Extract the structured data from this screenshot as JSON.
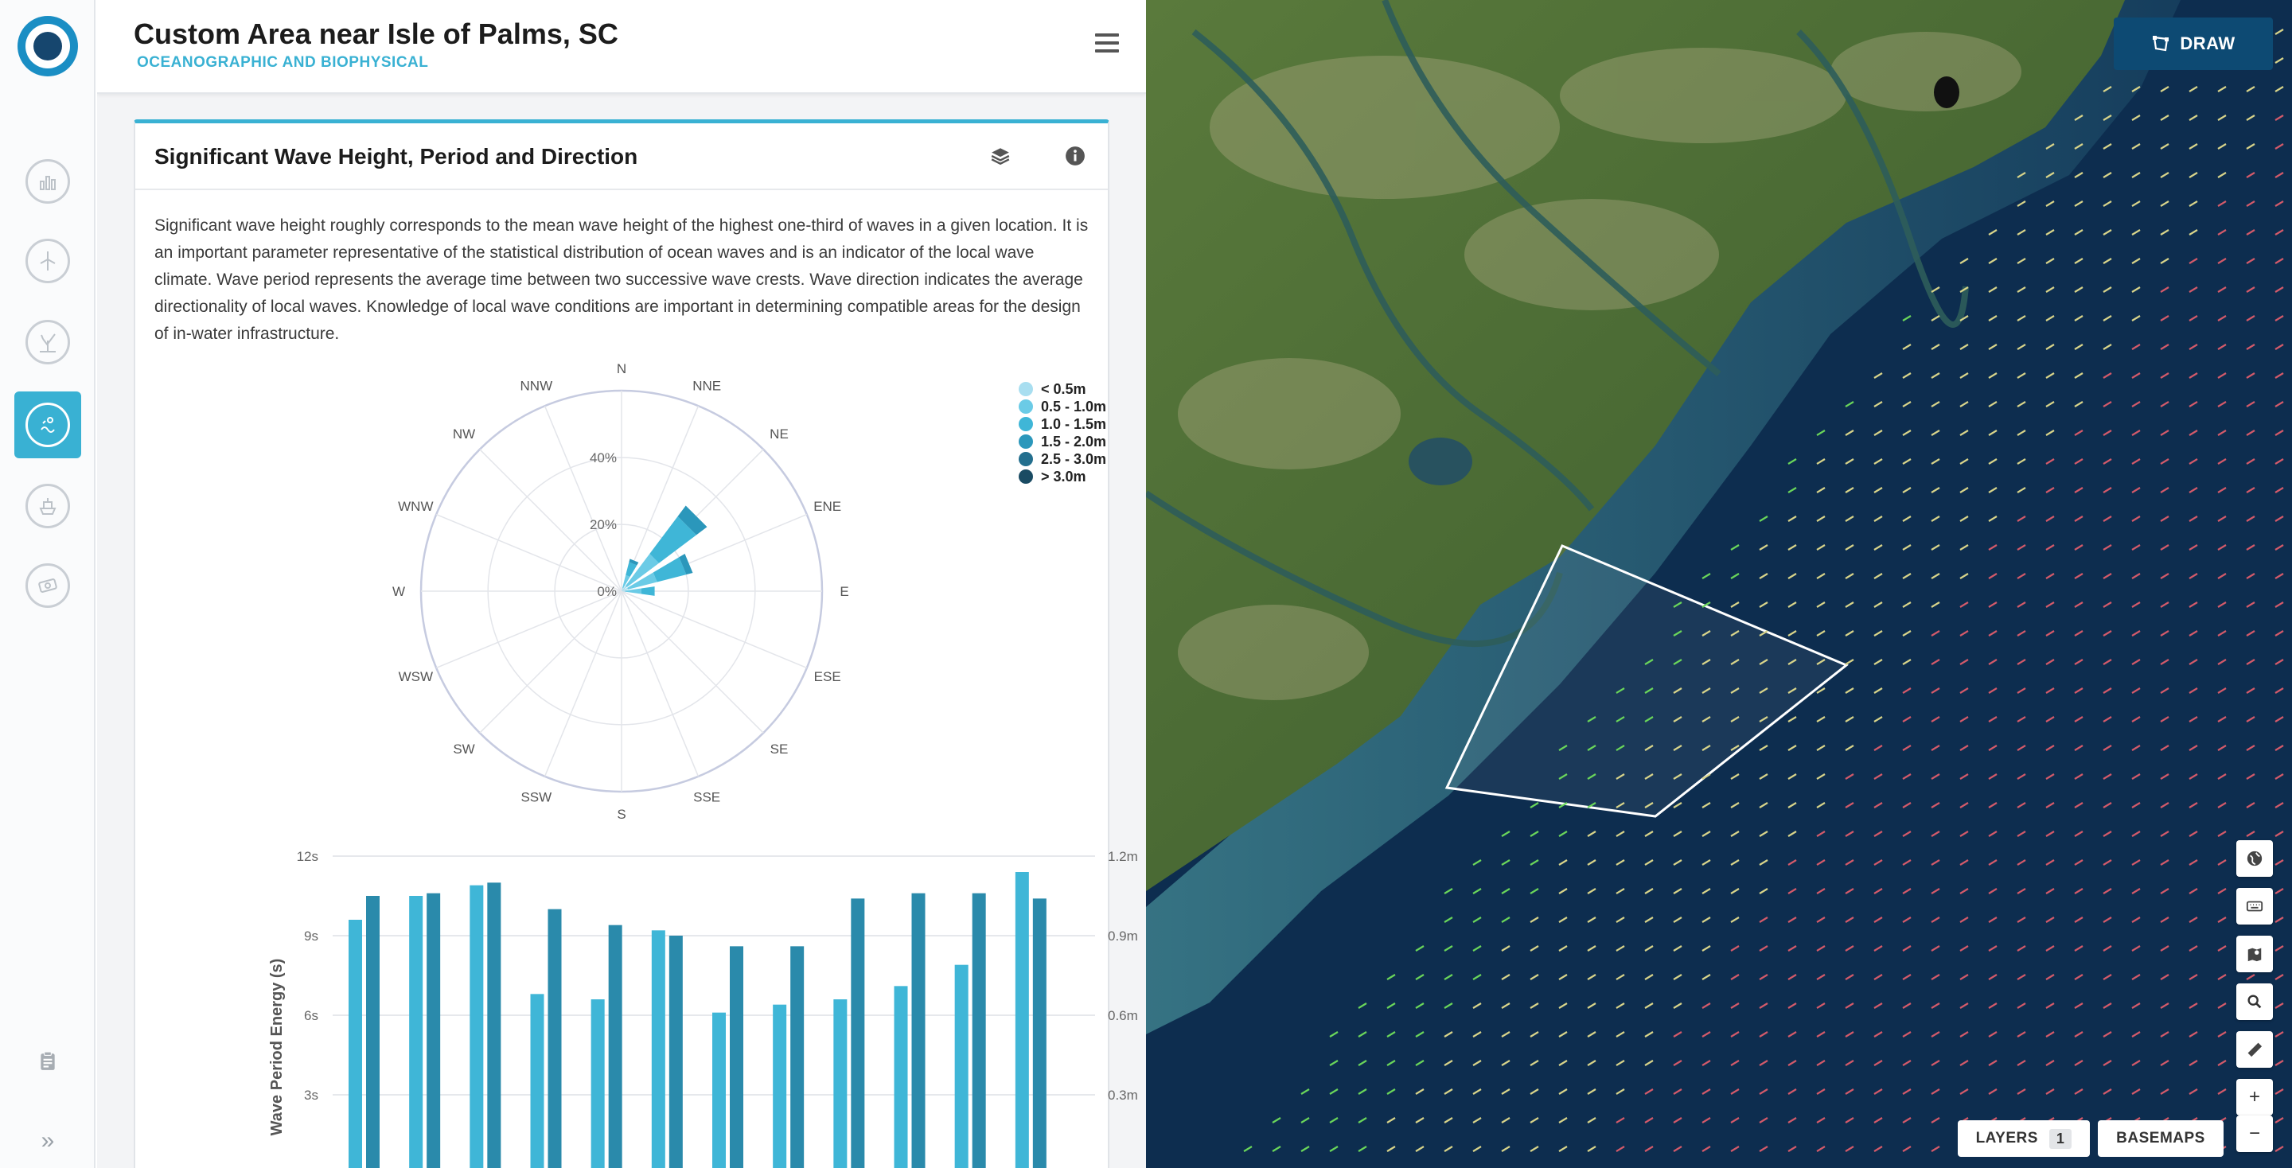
{
  "header": {
    "title": "Custom Area near Isle of Palms, SC",
    "subtitle": "OCEANOGRAPHIC AND BIOPHYSICAL"
  },
  "rail": {
    "items": [
      {
        "icon": "bar-chart-icon",
        "active": false
      },
      {
        "icon": "wind-turbine-icon",
        "active": false
      },
      {
        "icon": "coral-icon",
        "active": false
      },
      {
        "icon": "oceanographic-icon",
        "active": true
      },
      {
        "icon": "ship-icon",
        "active": false
      },
      {
        "icon": "money-icon",
        "active": false
      }
    ]
  },
  "card": {
    "title": "Significant Wave Height, Period and Direction",
    "description": "Significant wave height roughly corresponds to the mean wave height of the highest one-third of waves in a given location. It is an important parameter representative of the statistical distribution of ocean waves and is an indicator of the local wave climate. Wave period represents the average time between two successive wave crests. Wave direction indicates the average directionality of local waves. Knowledge of local wave conditions are important in determining compatible areas for the design of in-water infrastructure."
  },
  "legend": [
    {
      "label": "< 0.5m",
      "color": "#a8def0"
    },
    {
      "label": "0.5 - 1.0m",
      "color": "#6bcbe6"
    },
    {
      "label": "1.0 - 1.5m",
      "color": "#3fb6d7"
    },
    {
      "label": "1.5 - 2.0m",
      "color": "#2b97bb"
    },
    {
      "label": "2.5 - 3.0m",
      "color": "#236f8e"
    },
    {
      "label": "> 3.0m",
      "color": "#1a4b63"
    }
  ],
  "chart_data": [
    {
      "type": "polar-bar",
      "directions": [
        "N",
        "NNE",
        "NE",
        "ENE",
        "E",
        "ESE",
        "SE",
        "SSE",
        "S",
        "SSW",
        "SW",
        "WSW",
        "W",
        "WNW",
        "NW",
        "NNW"
      ],
      "radial_ticks": [
        "0%",
        "20%",
        "40%"
      ],
      "rmax": 60,
      "series": [
        {
          "name": "< 0.5m",
          "color": "#a8def0",
          "values": [
            0,
            1,
            2,
            2,
            1,
            0,
            0,
            0,
            0,
            0,
            0,
            0,
            0,
            0,
            0,
            0
          ]
        },
        {
          "name": "0.5 - 1.0m",
          "color": "#6bcbe6",
          "values": [
            0,
            4,
            12,
            9,
            5,
            0,
            0,
            0,
            0,
            0,
            0,
            0,
            0,
            0,
            0,
            0
          ]
        },
        {
          "name": "1.0 - 1.5m",
          "color": "#3fb6d7",
          "values": [
            0,
            4,
            14,
            9,
            4,
            0,
            0,
            0,
            0,
            0,
            0,
            0,
            0,
            0,
            0,
            0
          ]
        },
        {
          "name": "1.5 - 2.0m",
          "color": "#2b97bb",
          "values": [
            0,
            1,
            4,
            2,
            0,
            0,
            0,
            0,
            0,
            0,
            0,
            0,
            0,
            0,
            0,
            0
          ]
        },
        {
          "name": "2.5 - 3.0m",
          "color": "#236f8e",
          "values": [
            0,
            0,
            0,
            0,
            0,
            0,
            0,
            0,
            0,
            0,
            0,
            0,
            0,
            0,
            0,
            0
          ]
        },
        {
          "name": "> 3.0m",
          "color": "#1a4b63",
          "values": [
            0,
            0,
            0,
            0,
            0,
            0,
            0,
            0,
            0,
            0,
            0,
            0,
            0,
            0,
            0,
            0
          ]
        }
      ]
    },
    {
      "type": "bar",
      "ylabel": "Wave Period Energy (s)",
      "y2label": "Height (m)",
      "yticks": [
        "12s",
        "9s",
        "6s",
        "3s"
      ],
      "y2ticks": [
        "1.2m",
        "0.9m",
        "0.6m",
        "0.3m"
      ],
      "ylim": [
        0,
        12
      ],
      "y2lim": [
        0,
        1.2
      ],
      "series": [
        {
          "name": "Wave Period Energy (s)",
          "color": "#3fb6d7",
          "values": [
            9.6,
            10.5,
            10.9,
            6.8,
            6.6,
            9.2,
            6.1,
            6.4,
            6.6,
            7.1,
            7.9,
            11.4
          ]
        },
        {
          "name": "Height (m)",
          "color": "#2a8aab",
          "values": [
            1.05,
            1.06,
            1.1,
            1.0,
            0.94,
            0.9,
            0.86,
            0.86,
            1.04,
            1.06,
            1.06,
            1.04
          ]
        }
      ]
    }
  ],
  "map": {
    "draw_label": "DRAW",
    "layers_label": "LAYERS",
    "layers_count": "1",
    "basemaps_label": "BASEMAPS",
    "zoom_in": "+",
    "zoom_out": "−"
  }
}
